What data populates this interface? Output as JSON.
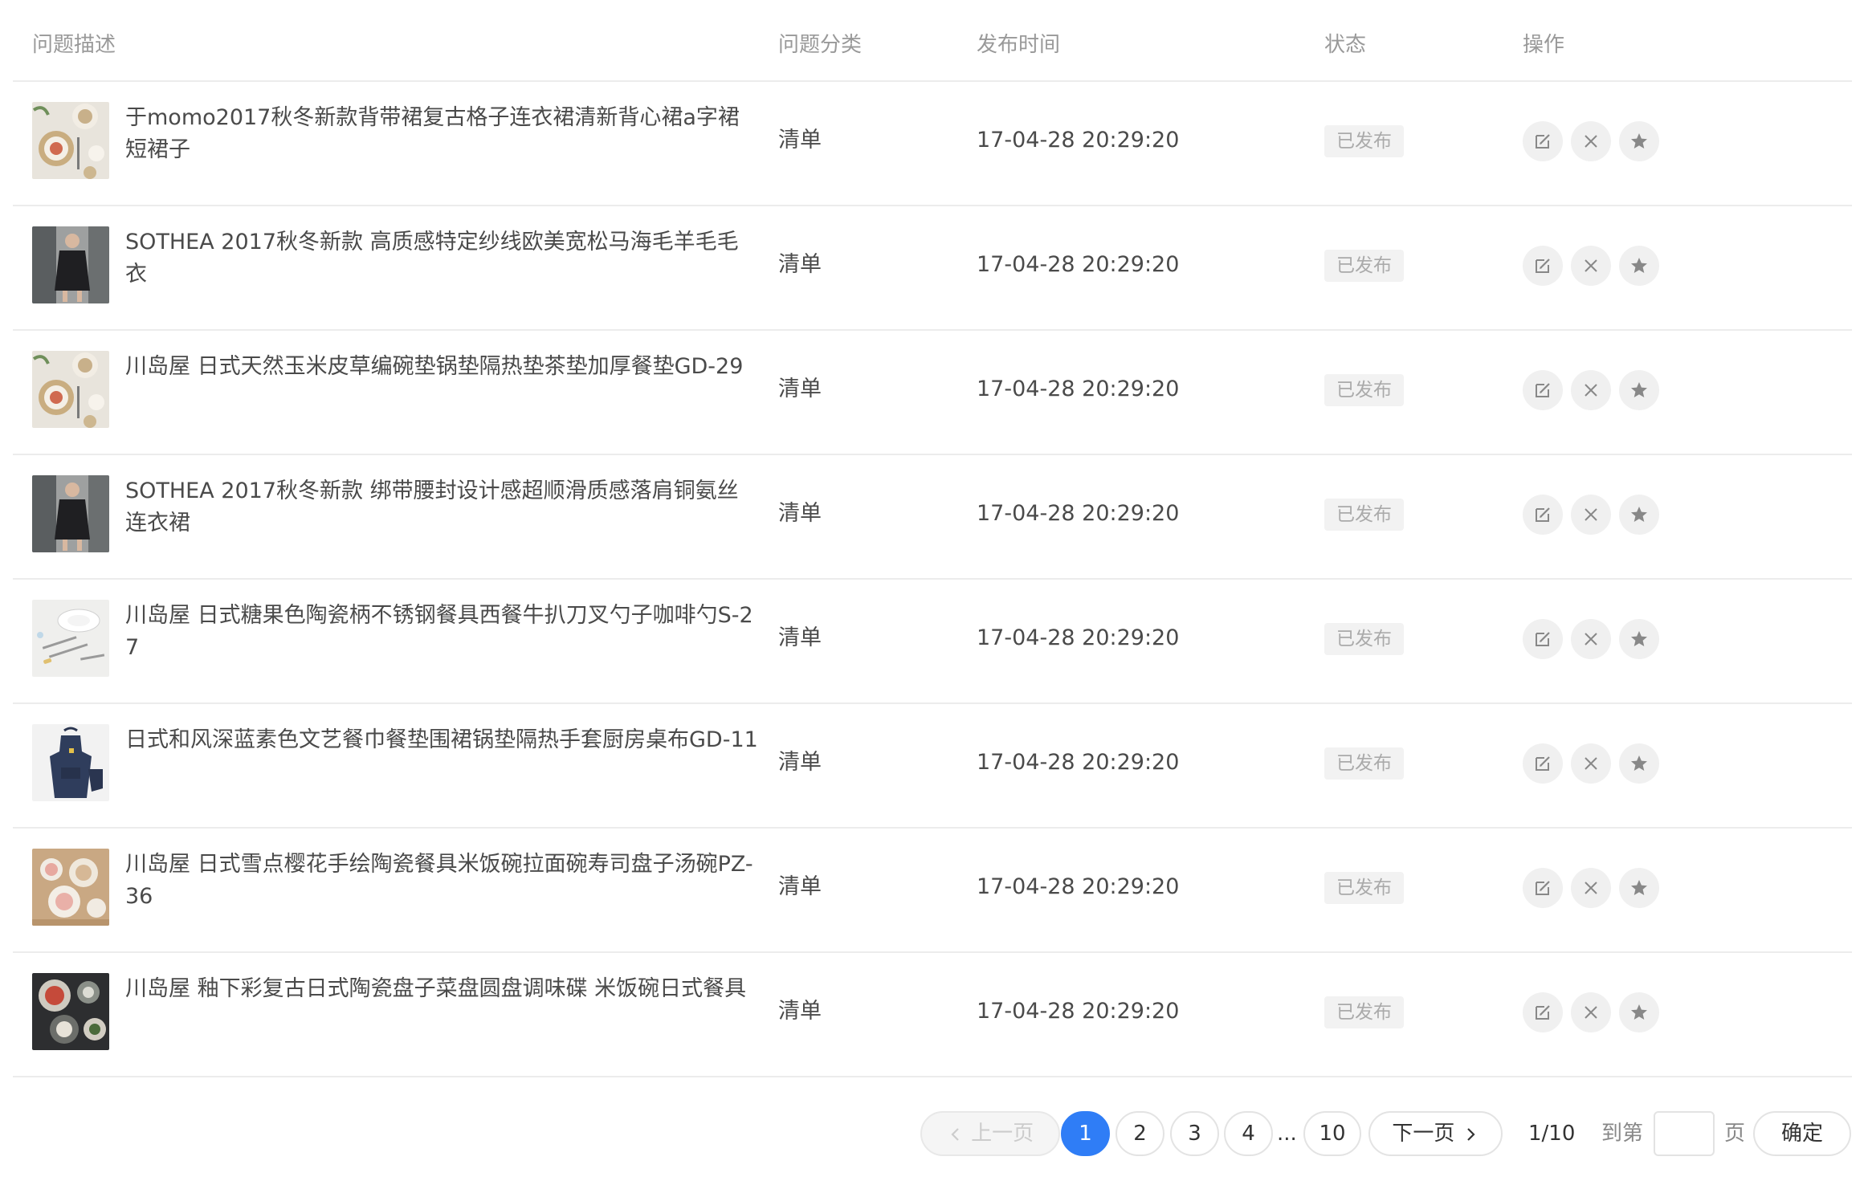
{
  "table": {
    "headers": {
      "description": "问题描述",
      "category": "问题分类",
      "published_time": "发布时间",
      "status": "状态",
      "actions": "操作"
    },
    "rows": [
      {
        "thumbnail": "tableware-thumbnail",
        "description": "于momo2017秋冬新款背带裙复古格子连衣裙清新背心裙a字裙短裙子",
        "category": "清单",
        "time": "17-04-28 20:29:20",
        "status": "已发布"
      },
      {
        "thumbnail": "fashion-thumbnail",
        "description": "SOTHEA 2017秋冬新款 高质感特定纱线欧美宽松马海毛羊毛毛衣",
        "category": "清单",
        "time": "17-04-28 20:29:20",
        "status": "已发布"
      },
      {
        "thumbnail": "tableware-thumbnail",
        "description": "川岛屋 日式天然玉米皮草编碗垫锅垫隔热垫茶垫加厚餐垫GD-29",
        "category": "清单",
        "time": "17-04-28 20:29:20",
        "status": "已发布"
      },
      {
        "thumbnail": "fashion-thumbnail",
        "description": "SOTHEA 2017秋冬新款 绑带腰封设计感超顺滑质感落肩铜氨丝连衣裙",
        "category": "清单",
        "time": "17-04-28 20:29:20",
        "status": "已发布"
      },
      {
        "thumbnail": "cutlery-thumbnail",
        "description": "川岛屋 日式糖果色陶瓷柄不锈钢餐具西餐牛扒刀叉勺子咖啡勺S-27",
        "category": "清单",
        "time": "17-04-28 20:29:20",
        "status": "已发布"
      },
      {
        "thumbnail": "apron-thumbnail",
        "description": "日式和风深蓝素色文艺餐巾餐垫围裙锅垫隔热手套厨房桌布GD-11",
        "category": "清单",
        "time": "17-04-28 20:29:20",
        "status": "已发布"
      },
      {
        "thumbnail": "dishes-thumbnail",
        "description": "川岛屋 日式雪点樱花手绘陶瓷餐具米饭碗拉面碗寿司盘子汤碗PZ-36",
        "category": "清单",
        "time": "17-04-28 20:29:20",
        "status": "已发布"
      },
      {
        "thumbnail": "dark-dishes-thumbnail",
        "description": "川岛屋 釉下彩复古日式陶瓷盘子菜盘圆盘调味碟 米饭碗日式餐具",
        "category": "清单",
        "time": "17-04-28 20:29:20",
        "status": "已发布"
      }
    ],
    "action_icons": [
      "edit-icon",
      "close-icon",
      "star-icon"
    ]
  },
  "pagination": {
    "prev_label": "上一页",
    "pages": [
      "1",
      "2",
      "3",
      "4"
    ],
    "ellipsis": "...",
    "last_page": "10",
    "current_page": "1",
    "next_label": "下一页",
    "page_count": "1/10",
    "goto_label": "到第",
    "goto_input_value": "",
    "page_unit": "页",
    "confirm_label": "确定"
  },
  "colors": {
    "accent": "#2f7df6",
    "header_text": "#999999",
    "body_text": "#4a4a4a",
    "status_bg": "#f2f2f2",
    "status_text": "#aaaaaa",
    "divider": "#ececec"
  }
}
